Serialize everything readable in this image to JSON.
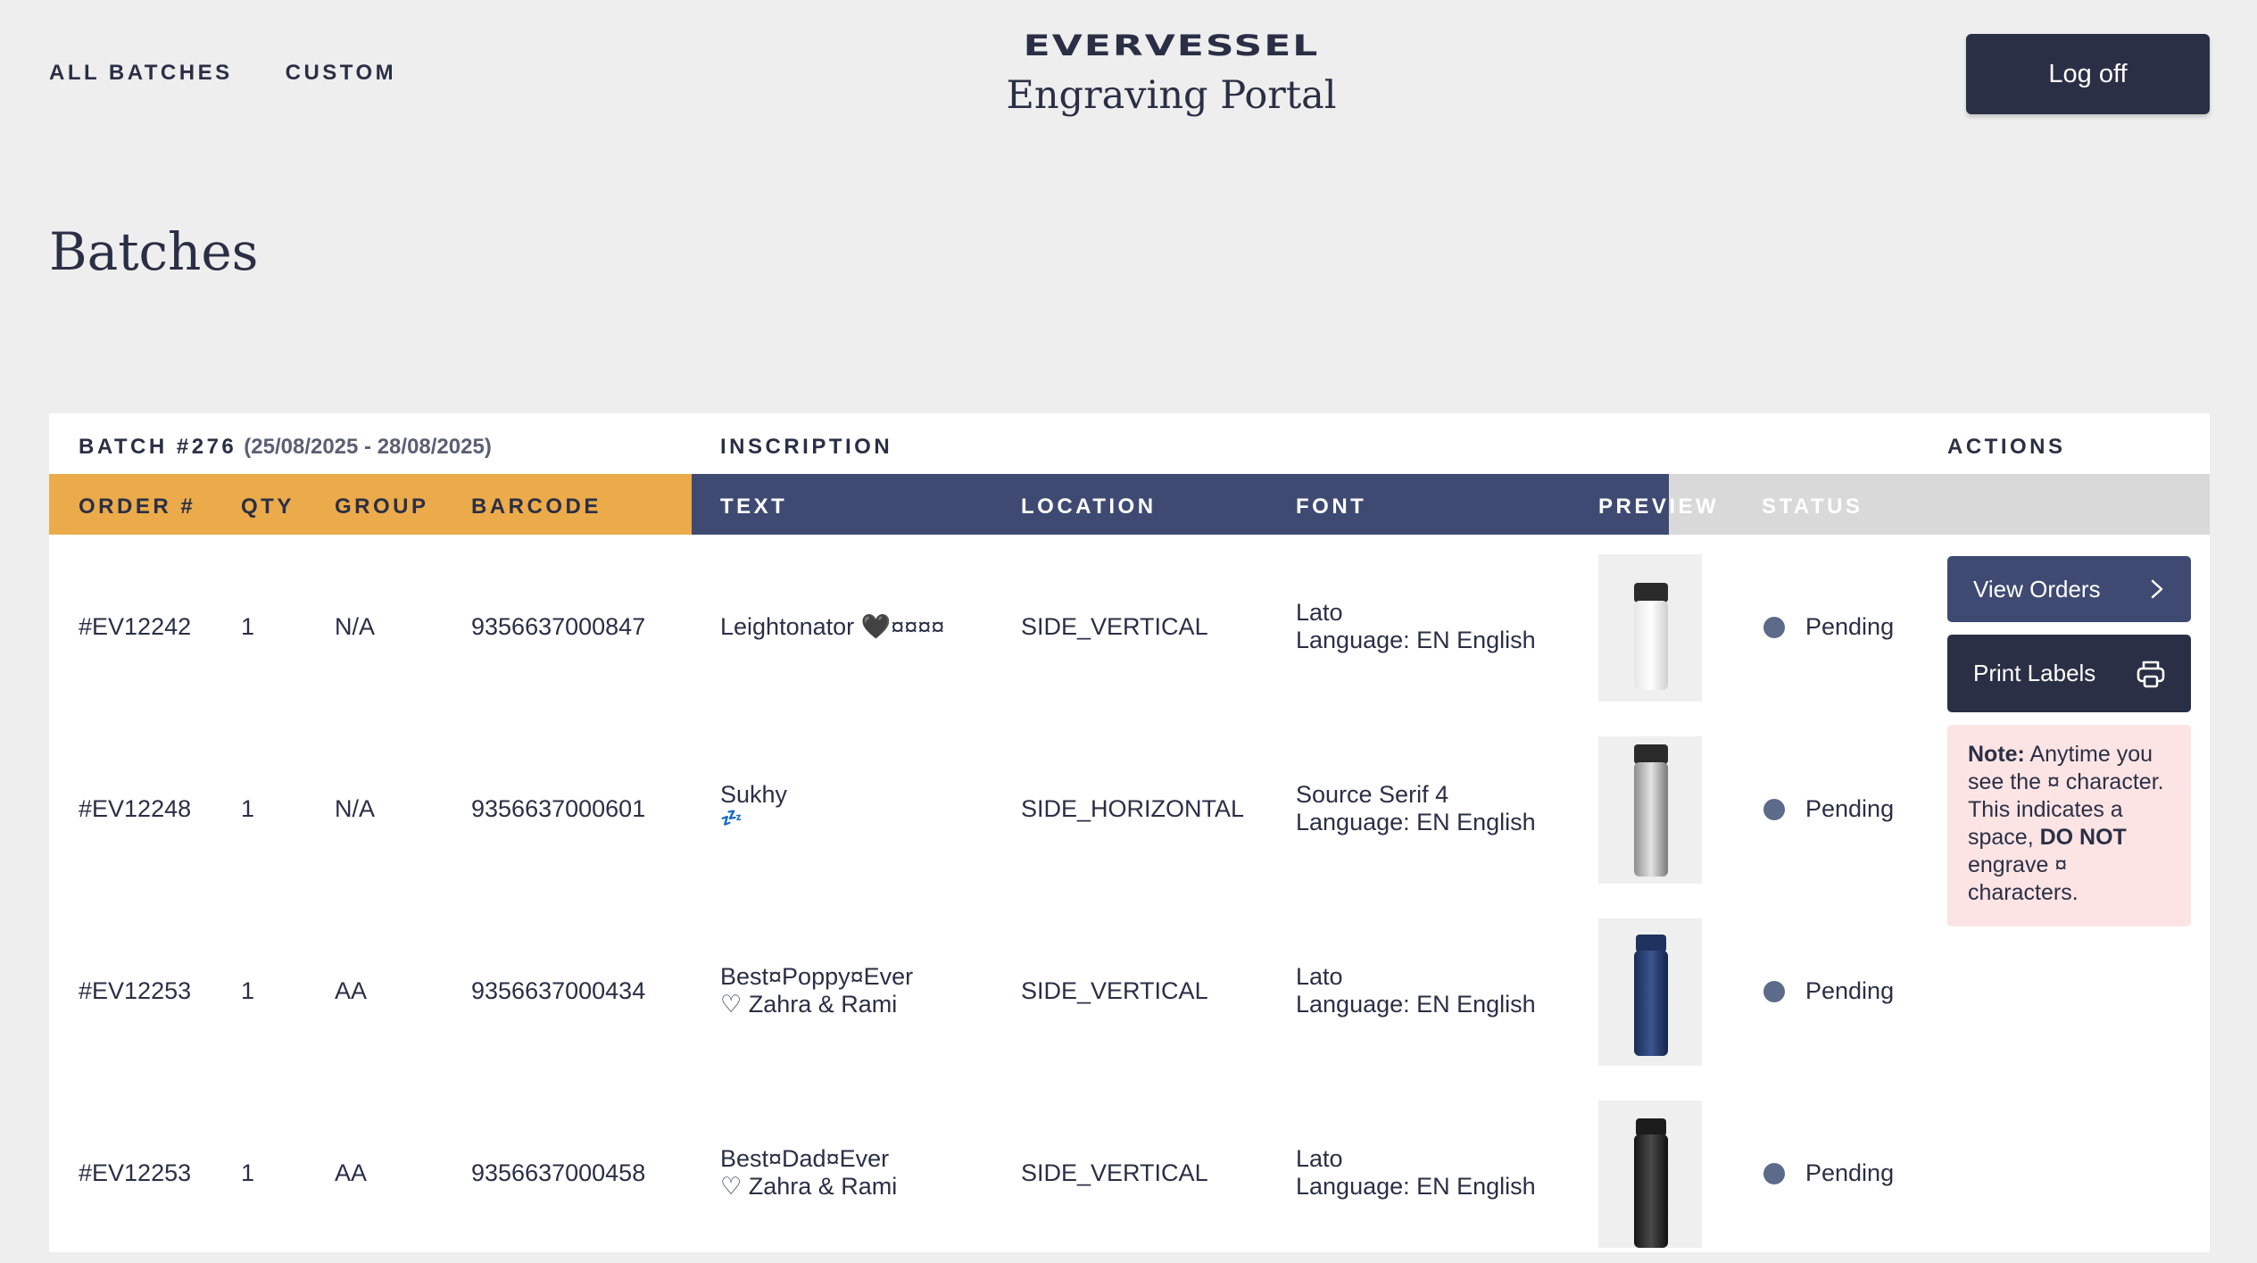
{
  "nav": {
    "all_batches": "ALL BATCHES",
    "custom": "CUSTOM"
  },
  "brand": {
    "logo": "EVERVESSEL",
    "subtitle": "Engraving Portal"
  },
  "header": {
    "logoff": "Log off"
  },
  "page": {
    "title": "Batches"
  },
  "batch": {
    "label": "BATCH #276",
    "range": "(25/08/2025 - 28/08/2025)",
    "inscription_label": "INSCRIPTION",
    "actions_label": "ACTIONS"
  },
  "columns": {
    "order": "ORDER #",
    "qty": "QTY",
    "group": "GROUP",
    "barcode": "BARCODE",
    "text": "TEXT",
    "location": "LOCATION",
    "font": "FONT",
    "preview": "PREVIEW",
    "status": "STATUS"
  },
  "colors": {
    "orange": "#ecab4b",
    "navy": "#3f4a73",
    "dark": "#2b2f45",
    "note_bg": "#fde4e4",
    "status_dot": "#5c6b8a"
  },
  "rows": [
    {
      "order": "#EV12242",
      "qty": "1",
      "group": "N/A",
      "barcode": "9356637000847",
      "text_line1": "Leightonator 🖤¤¤¤¤",
      "text_line2": "",
      "location": "SIDE_VERTICAL",
      "font_name": "Lato",
      "font_lang": "Language: EN English",
      "preview": "white-bottle",
      "status": "Pending"
    },
    {
      "order": "#EV12248",
      "qty": "1",
      "group": "N/A",
      "barcode": "9356637000601",
      "text_line1": "Sukhy",
      "text_line2": "💤",
      "location": "SIDE_HORIZONTAL",
      "font_name": "Source Serif 4",
      "font_lang": "Language: EN English",
      "preview": "silver-bottle",
      "status": "Pending"
    },
    {
      "order": "#EV12253",
      "qty": "1",
      "group": "AA",
      "barcode": "9356637000434",
      "text_line1": "Best¤Poppy¤Ever",
      "text_line2": "♡ Zahra & Rami",
      "location": "SIDE_VERTICAL",
      "font_name": "Lato",
      "font_lang": "Language: EN English",
      "preview": "navy-bottle",
      "status": "Pending"
    },
    {
      "order": "#EV12253",
      "qty": "1",
      "group": "AA",
      "barcode": "9356637000458",
      "text_line1": "Best¤Dad¤Ever",
      "text_line2": "♡ Zahra & Rami",
      "location": "SIDE_VERTICAL",
      "font_name": "Lato",
      "font_lang": "Language: EN English",
      "preview": "black-bottle",
      "status": "Pending"
    }
  ],
  "actions": {
    "view_orders": "View Orders",
    "print_labels": "Print Labels",
    "note_label": "Note:",
    "note_text1": " Anytime you see the ¤ character. This indicates a space, ",
    "note_bold": "DO NOT",
    "note_text2": " engrave ¤ characters."
  }
}
